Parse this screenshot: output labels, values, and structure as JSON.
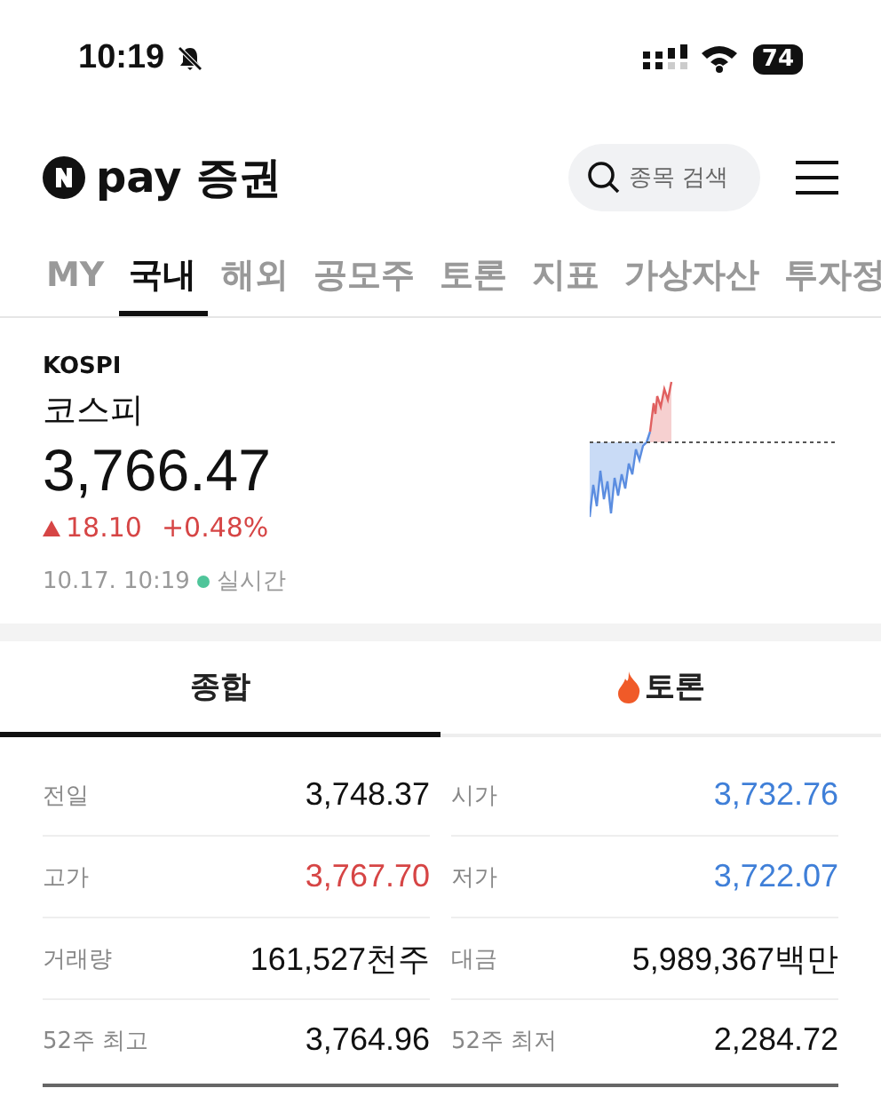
{
  "status_bar": {
    "time": "10:19",
    "battery": "74"
  },
  "header": {
    "logo_text": "pay 증권",
    "search": {
      "placeholder": "종목 검색"
    }
  },
  "tabs": [
    {
      "label": "MY",
      "selected": false
    },
    {
      "label": "국내",
      "selected": true
    },
    {
      "label": "해외",
      "selected": false
    },
    {
      "label": "공모주",
      "selected": false
    },
    {
      "label": "토론",
      "selected": false
    },
    {
      "label": "지표",
      "selected": false
    },
    {
      "label": "가상자산",
      "selected": false
    },
    {
      "label": "투자정",
      "selected": false
    }
  ],
  "index": {
    "code": "KOSPI",
    "name": "코스피",
    "value": "3,766.47",
    "rising": true,
    "change": "18.10",
    "change_percent": "+0.48%",
    "timestamp": "10.17. 10:19",
    "live_label": "실시간"
  },
  "sub_tabs": [
    {
      "label": "종합",
      "selected": true,
      "kind": "plain"
    },
    {
      "label": "토론",
      "selected": false,
      "kind": "fire"
    }
  ],
  "stats": [
    {
      "label": "전일",
      "value": "3,748.37",
      "color": "#111111"
    },
    {
      "label": "시가",
      "value": "3,732.76",
      "color": "#3f7fd8"
    },
    {
      "label": "고가",
      "value": "3,767.70",
      "color": "#d64545"
    },
    {
      "label": "저가",
      "value": "3,722.07",
      "color": "#3f7fd8"
    },
    {
      "label": "거래량",
      "value": "161,527천주",
      "color": "#111111"
    },
    {
      "label": "대금",
      "value": "5,989,367백만",
      "color": "#111111"
    },
    {
      "label": "52주 최고",
      "value": "3,764.96",
      "color": "#111111"
    },
    {
      "label": "52주 최저",
      "value": "2,284.72",
      "color": "#111111"
    }
  ]
}
